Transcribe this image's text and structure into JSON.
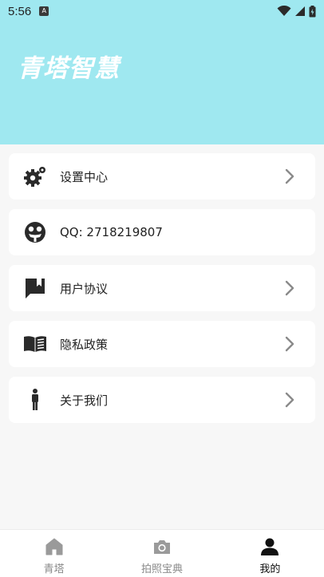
{
  "status_bar": {
    "time": "5:56",
    "notification_icon": "a-icon"
  },
  "header": {
    "title": "青塔智慧",
    "background_color": "#9fe8f0"
  },
  "menu": {
    "items": [
      {
        "label": "设置中心",
        "icon": "settings-gears-icon",
        "has_chevron": true
      },
      {
        "label": "QQ: 2718219807",
        "icon": "qq-icon",
        "has_chevron": false
      },
      {
        "label": "用户协议",
        "icon": "bookmark-chat-icon",
        "has_chevron": true
      },
      {
        "label": "隐私政策",
        "icon": "book-icon",
        "has_chevron": true
      },
      {
        "label": "关于我们",
        "icon": "person-icon",
        "has_chevron": true
      }
    ]
  },
  "bottom_nav": {
    "items": [
      {
        "label": "青塔",
        "icon": "home-icon",
        "active": false
      },
      {
        "label": "拍照宝典",
        "icon": "camera-icon",
        "active": false
      },
      {
        "label": "我的",
        "icon": "profile-icon",
        "active": true
      }
    ]
  }
}
